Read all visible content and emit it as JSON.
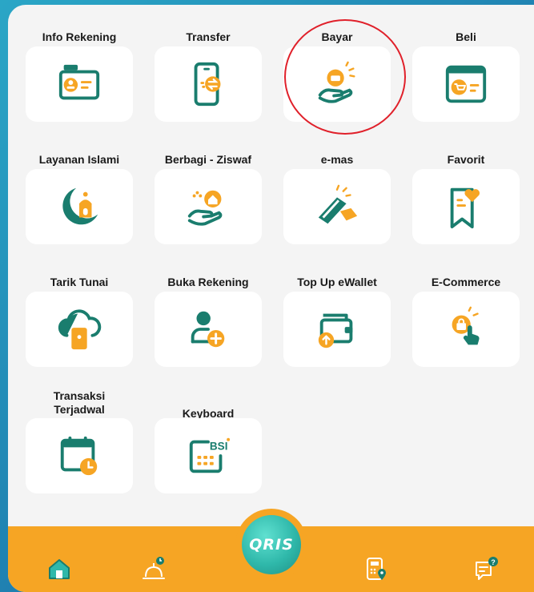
{
  "menu": [
    {
      "label": "Info Rekening",
      "icon": "id-card-icon"
    },
    {
      "label": "Transfer",
      "icon": "phone-transfer-icon"
    },
    {
      "label": "Bayar",
      "icon": "hand-card-icon"
    },
    {
      "label": "Beli",
      "icon": "browser-cart-icon"
    },
    {
      "label": "Layanan Islami",
      "icon": "crescent-mosque-icon"
    },
    {
      "label": "Berbagi - Ziswaf",
      "icon": "hand-house-icon"
    },
    {
      "label": "e-mas",
      "icon": "gold-bar-icon"
    },
    {
      "label": "Favorit",
      "icon": "bookmark-heart-icon"
    },
    {
      "label": "Tarik Tunai",
      "icon": "cloud-atm-icon"
    },
    {
      "label": "Buka Rekening",
      "icon": "add-user-icon"
    },
    {
      "label": "Top Up eWallet",
      "icon": "wallet-upload-icon"
    },
    {
      "label": "E-Commerce",
      "icon": "shopping-bag-tap-icon"
    },
    {
      "label": "Transaksi\nTerjadwal",
      "icon": "calendar-clock-icon"
    },
    {
      "label": "Keyboard",
      "icon": "bsi-keyboard-icon"
    }
  ],
  "keyboard_badge": "BSI",
  "highlight": "Bayar",
  "bottom_nav": {
    "qris_label": "QRIS",
    "items": [
      "home-icon",
      "mosque-icon",
      "qris-button",
      "calculator-location-icon",
      "chat-help-icon"
    ]
  },
  "colors": {
    "accent_orange": "#f6a524",
    "teal": "#1a7d6e",
    "qris_teal": "#2fb8aa",
    "highlight_red": "#e0202a"
  }
}
